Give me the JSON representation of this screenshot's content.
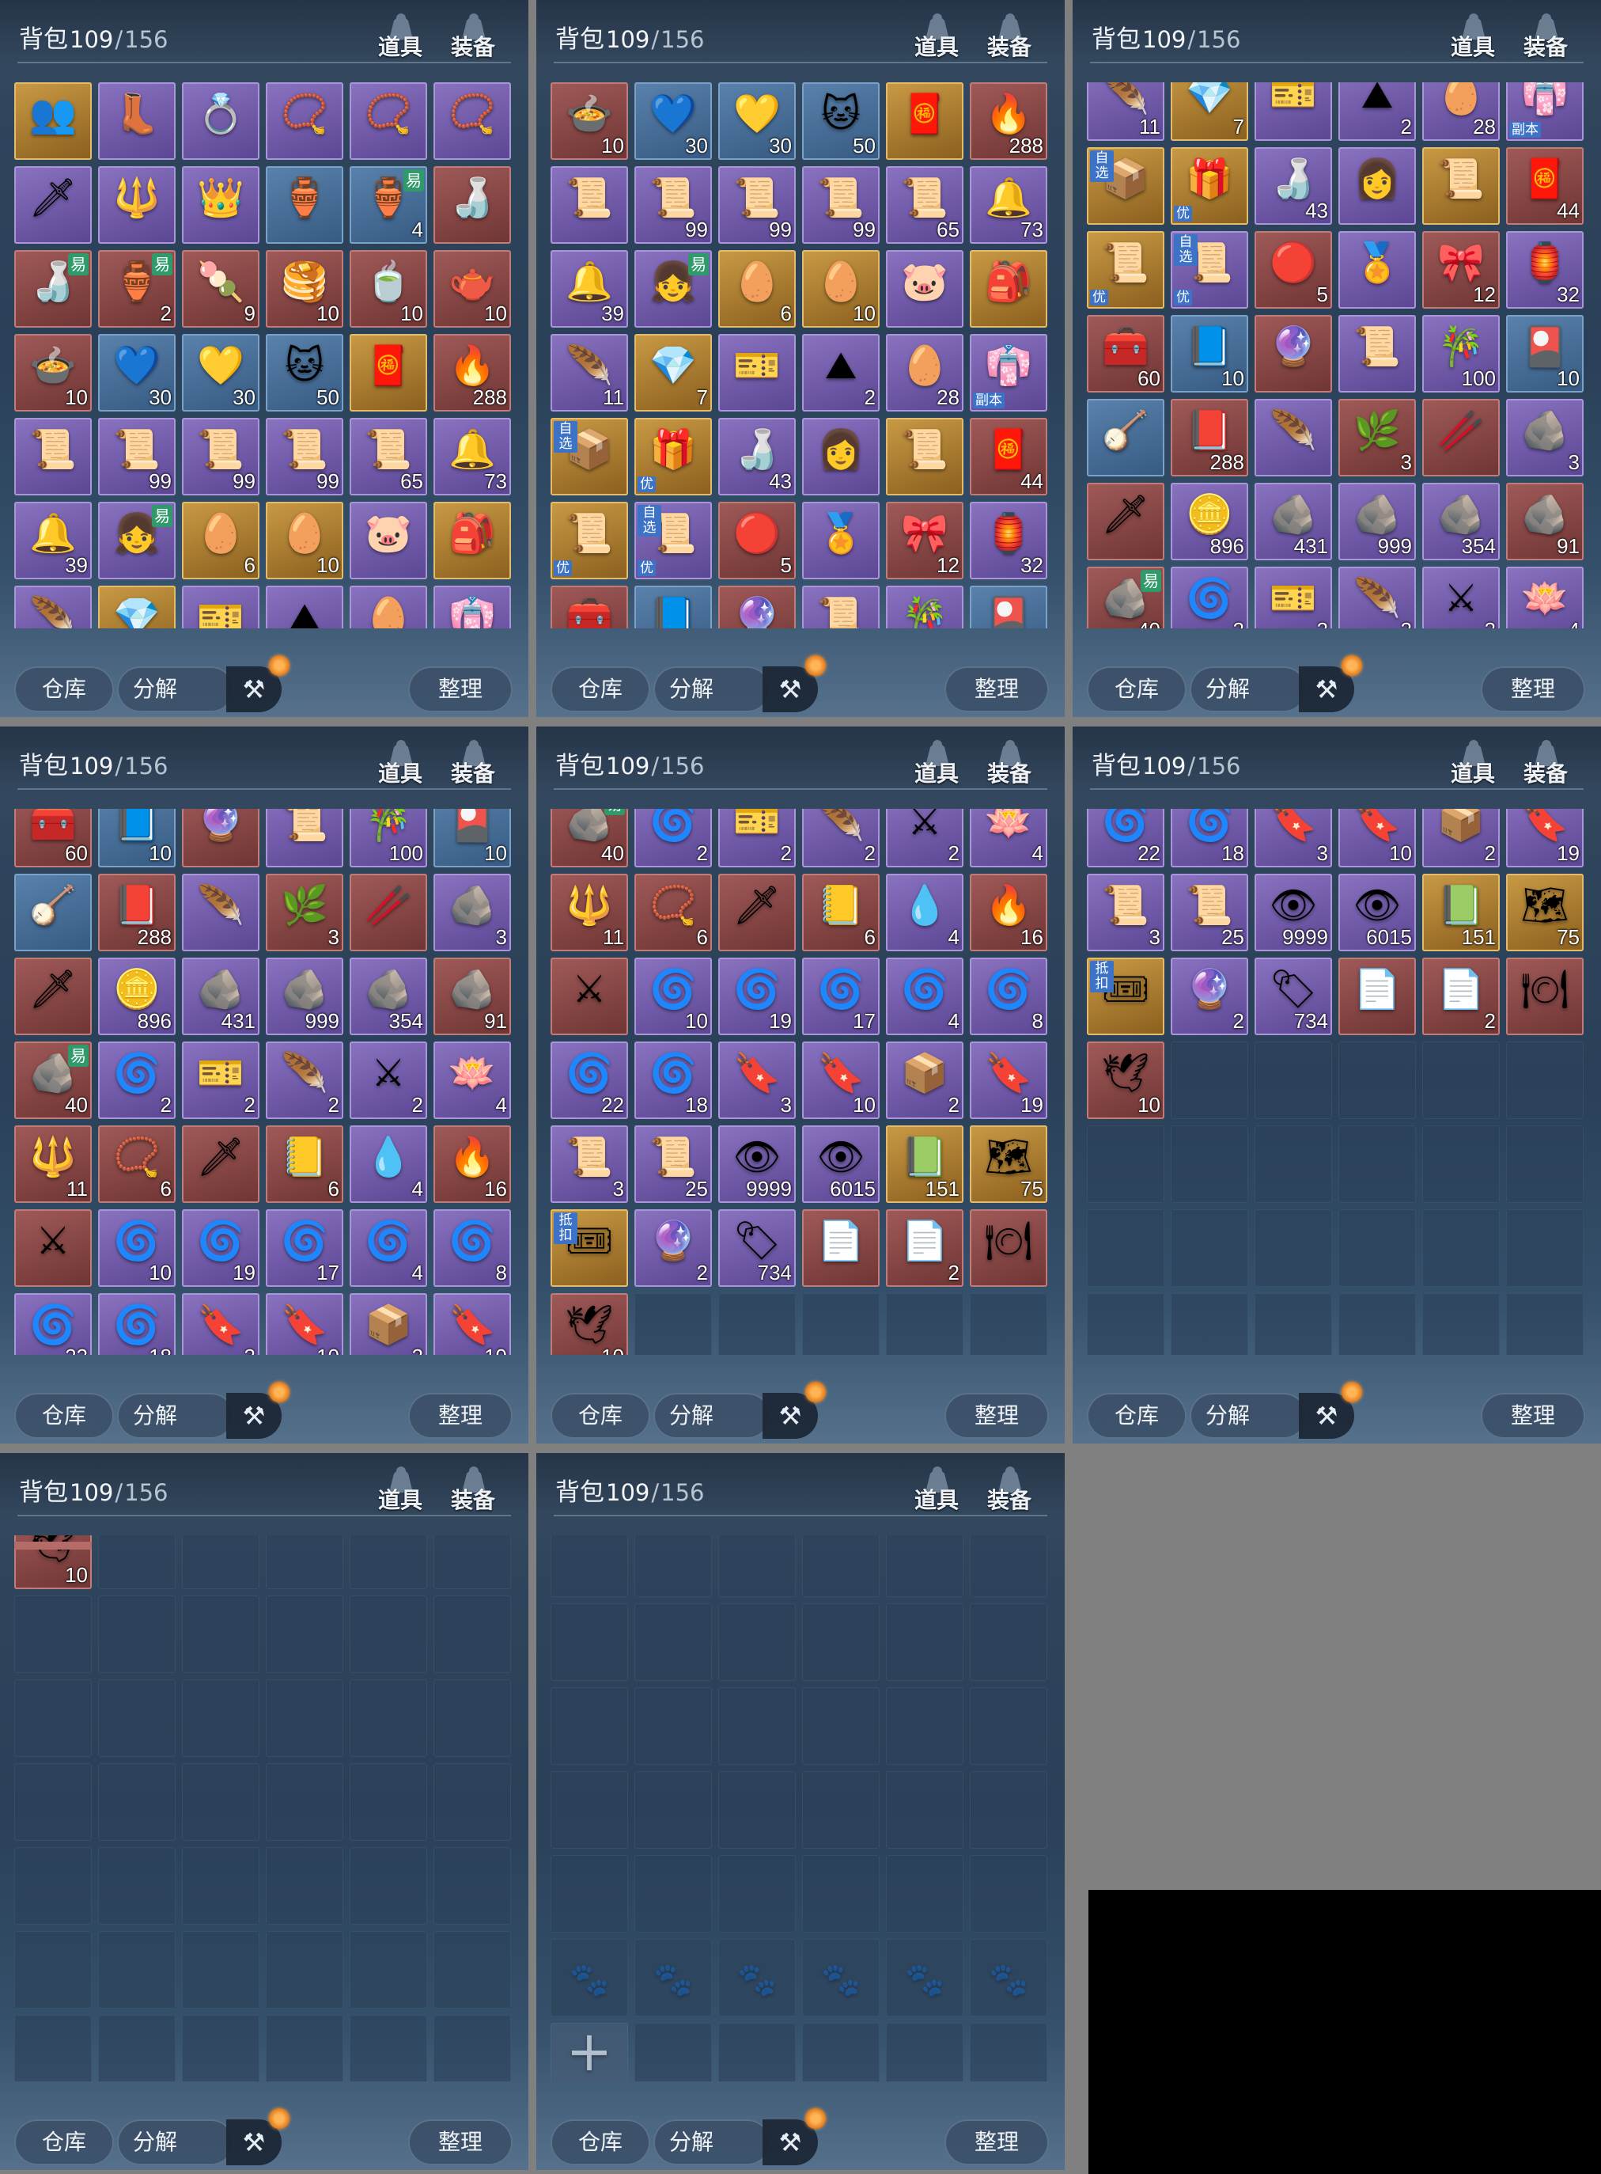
{
  "header": {
    "title": "背包",
    "count": "109",
    "separator": "/",
    "capacity": "156",
    "tab_items": "道具",
    "tab_equip": "装备"
  },
  "footer": {
    "warehouse": "仓库",
    "decompose": "分解",
    "sort": "整理"
  },
  "icons": {
    "tab_items": "bag-icon",
    "tab_equip": "armor-icon",
    "decompose_tool": "hammer-icon",
    "pet_slot": "paw-icon",
    "expand_slot": "plus-icon"
  },
  "colors": {
    "purple": "#6f5aa8",
    "gold": "#b0823a",
    "red": "#8a4846",
    "blue": "#4a729c",
    "badge_tradable": "#2f9a6a",
    "badge_label": "#3d73c7",
    "notify_dot": "#e88a2a"
  },
  "items": [
    {
      "r": "gold",
      "g": "👥"
    },
    {
      "r": "purple",
      "g": "👢"
    },
    {
      "r": "purple",
      "g": "💍"
    },
    {
      "r": "purple",
      "g": "📿"
    },
    {
      "r": "purple",
      "g": "📿"
    },
    {
      "r": "purple",
      "g": "📿"
    },
    {
      "r": "purple",
      "g": "🗡"
    },
    {
      "r": "purple",
      "g": "🔱"
    },
    {
      "r": "purple",
      "g": "👑"
    },
    {
      "r": "blue",
      "g": "🏺"
    },
    {
      "r": "blue",
      "g": "🏺",
      "n": "4",
      "t": "易"
    },
    {
      "r": "red",
      "g": "🍶"
    },
    {
      "r": "red",
      "g": "🍶",
      "t": "易"
    },
    {
      "r": "red",
      "g": "🏺",
      "n": "2",
      "t": "易"
    },
    {
      "r": "red",
      "g": "🍡",
      "n": "9"
    },
    {
      "r": "red",
      "g": "🥞",
      "n": "10"
    },
    {
      "r": "red",
      "g": "🍵",
      "n": "10"
    },
    {
      "r": "red",
      "g": "🫖",
      "n": "10"
    },
    {
      "r": "red",
      "g": "🍲",
      "n": "10"
    },
    {
      "r": "blue",
      "g": "💙",
      "n": "30"
    },
    {
      "r": "blue",
      "g": "💛",
      "n": "30"
    },
    {
      "r": "blue",
      "g": "🐱",
      "n": "50"
    },
    {
      "r": "gold",
      "g": "🧧"
    },
    {
      "r": "red",
      "g": "🔥",
      "n": "288"
    },
    {
      "r": "purple",
      "g": "📜"
    },
    {
      "r": "purple",
      "g": "📜",
      "n": "99"
    },
    {
      "r": "purple",
      "g": "📜",
      "n": "99"
    },
    {
      "r": "purple",
      "g": "📜",
      "n": "99"
    },
    {
      "r": "purple",
      "g": "📜",
      "n": "65"
    },
    {
      "r": "purple",
      "g": "🔔",
      "n": "73"
    },
    {
      "r": "purple",
      "g": "🔔",
      "n": "39"
    },
    {
      "r": "purple",
      "g": "👧",
      "t": "易"
    },
    {
      "r": "gold",
      "g": "🥚",
      "n": "6"
    },
    {
      "r": "gold",
      "g": "🥚",
      "n": "10"
    },
    {
      "r": "purple",
      "g": "🐷"
    },
    {
      "r": "gold",
      "g": "🎒"
    },
    {
      "r": "purple",
      "g": "🪶",
      "n": "11"
    },
    {
      "r": "gold",
      "g": "💎",
      "n": "7"
    },
    {
      "r": "purple",
      "g": "🎫"
    },
    {
      "r": "purple",
      "g": "⛰",
      "n": "2"
    },
    {
      "r": "purple",
      "g": "🥚",
      "n": "28"
    },
    {
      "r": "purple",
      "g": "👘",
      "b": "副本"
    },
    {
      "r": "gold",
      "g": "📦",
      "l": "自选"
    },
    {
      "r": "gold",
      "g": "🎁",
      "b": "优"
    },
    {
      "r": "purple",
      "g": "🍶",
      "n": "43"
    },
    {
      "r": "purple",
      "g": "👩"
    },
    {
      "r": "gold",
      "g": "📜"
    },
    {
      "r": "red",
      "g": "🧧",
      "n": "44"
    },
    {
      "r": "gold",
      "g": "📜",
      "b": "优"
    },
    {
      "r": "purple",
      "g": "📜",
      "l": "自选",
      "b": "优"
    },
    {
      "r": "red",
      "g": "🔴",
      "n": "5"
    },
    {
      "r": "purple",
      "g": "🏅"
    },
    {
      "r": "red",
      "g": "🎀",
      "n": "12"
    },
    {
      "r": "purple",
      "g": "🏮",
      "n": "32"
    },
    {
      "r": "red",
      "g": "🧰",
      "n": "60"
    },
    {
      "r": "blue",
      "g": "📘",
      "n": "10"
    },
    {
      "r": "red",
      "g": "🔮"
    },
    {
      "r": "purple",
      "g": "📜"
    },
    {
      "r": "purple",
      "g": "🎋",
      "n": "100"
    },
    {
      "r": "blue",
      "g": "🎴",
      "n": "10"
    },
    {
      "r": "blue",
      "g": "🪕"
    },
    {
      "r": "red",
      "g": "📕",
      "n": "288"
    },
    {
      "r": "purple",
      "g": "🪶"
    },
    {
      "r": "red",
      "g": "🌿",
      "n": "3"
    },
    {
      "r": "red",
      "g": "🥢"
    },
    {
      "r": "purple",
      "g": "🪨",
      "n": "3"
    },
    {
      "r": "red",
      "g": "🗡"
    },
    {
      "r": "purple",
      "g": "🪙",
      "n": "896"
    },
    {
      "r": "purple",
      "g": "🪨",
      "n": "431"
    },
    {
      "r": "purple",
      "g": "🪨",
      "n": "999"
    },
    {
      "r": "purple",
      "g": "🪨",
      "n": "354"
    },
    {
      "r": "red",
      "g": "🪨",
      "n": "91"
    },
    {
      "r": "red",
      "g": "🪨",
      "n": "40",
      "t": "易"
    },
    {
      "r": "purple",
      "g": "🌀",
      "n": "2"
    },
    {
      "r": "purple",
      "g": "🎫",
      "n": "2"
    },
    {
      "r": "purple",
      "g": "🪶",
      "n": "2"
    },
    {
      "r": "purple",
      "g": "⚔",
      "n": "2"
    },
    {
      "r": "purple",
      "g": "🪷",
      "n": "4"
    },
    {
      "r": "red",
      "g": "🔱",
      "n": "11"
    },
    {
      "r": "red",
      "g": "📿",
      "n": "6"
    },
    {
      "r": "red",
      "g": "🗡"
    },
    {
      "r": "red",
      "g": "📒",
      "n": "6"
    },
    {
      "r": "purple",
      "g": "💧",
      "n": "4"
    },
    {
      "r": "red",
      "g": "🔥",
      "n": "16"
    },
    {
      "r": "red",
      "g": "⚔"
    },
    {
      "r": "purple",
      "g": "🌀",
      "n": "10"
    },
    {
      "r": "purple",
      "g": "🌀",
      "n": "19"
    },
    {
      "r": "purple",
      "g": "🌀",
      "n": "17"
    },
    {
      "r": "purple",
      "g": "🌀",
      "n": "4"
    },
    {
      "r": "purple",
      "g": "🌀",
      "n": "8"
    },
    {
      "r": "purple",
      "g": "🌀",
      "n": "22"
    },
    {
      "r": "purple",
      "g": "🌀",
      "n": "18"
    },
    {
      "r": "purple",
      "g": "🔖",
      "n": "3"
    },
    {
      "r": "purple",
      "g": "🔖",
      "n": "10"
    },
    {
      "r": "purple",
      "g": "📦",
      "n": "2"
    },
    {
      "r": "purple",
      "g": "🔖",
      "n": "19"
    },
    {
      "r": "purple",
      "g": "📜",
      "n": "3"
    },
    {
      "r": "purple",
      "g": "📜",
      "n": "25"
    },
    {
      "r": "purple",
      "g": "👁",
      "n": "9999"
    },
    {
      "r": "purple",
      "g": "👁",
      "n": "6015"
    },
    {
      "r": "gold",
      "g": "📗",
      "n": "151"
    },
    {
      "r": "gold",
      "g": "🗺",
      "n": "75"
    },
    {
      "r": "gold",
      "g": "🎟",
      "l": "抵扣"
    },
    {
      "r": "purple",
      "g": "🔮",
      "n": "2"
    },
    {
      "r": "purple",
      "g": "🏷",
      "n": "734"
    },
    {
      "r": "red",
      "g": "📄"
    },
    {
      "r": "red",
      "g": "📄",
      "n": "2"
    },
    {
      "r": "red",
      "g": "🍽"
    },
    {
      "r": "red",
      "g": "🕊",
      "n": "10"
    }
  ],
  "panels": [
    {
      "start": 0
    },
    {
      "start": 18
    },
    {
      "start": 36
    },
    {
      "start": 54
    },
    {
      "start": 72
    },
    {
      "start": 90
    },
    {
      "start": 108
    },
    {
      "start": 114
    }
  ]
}
